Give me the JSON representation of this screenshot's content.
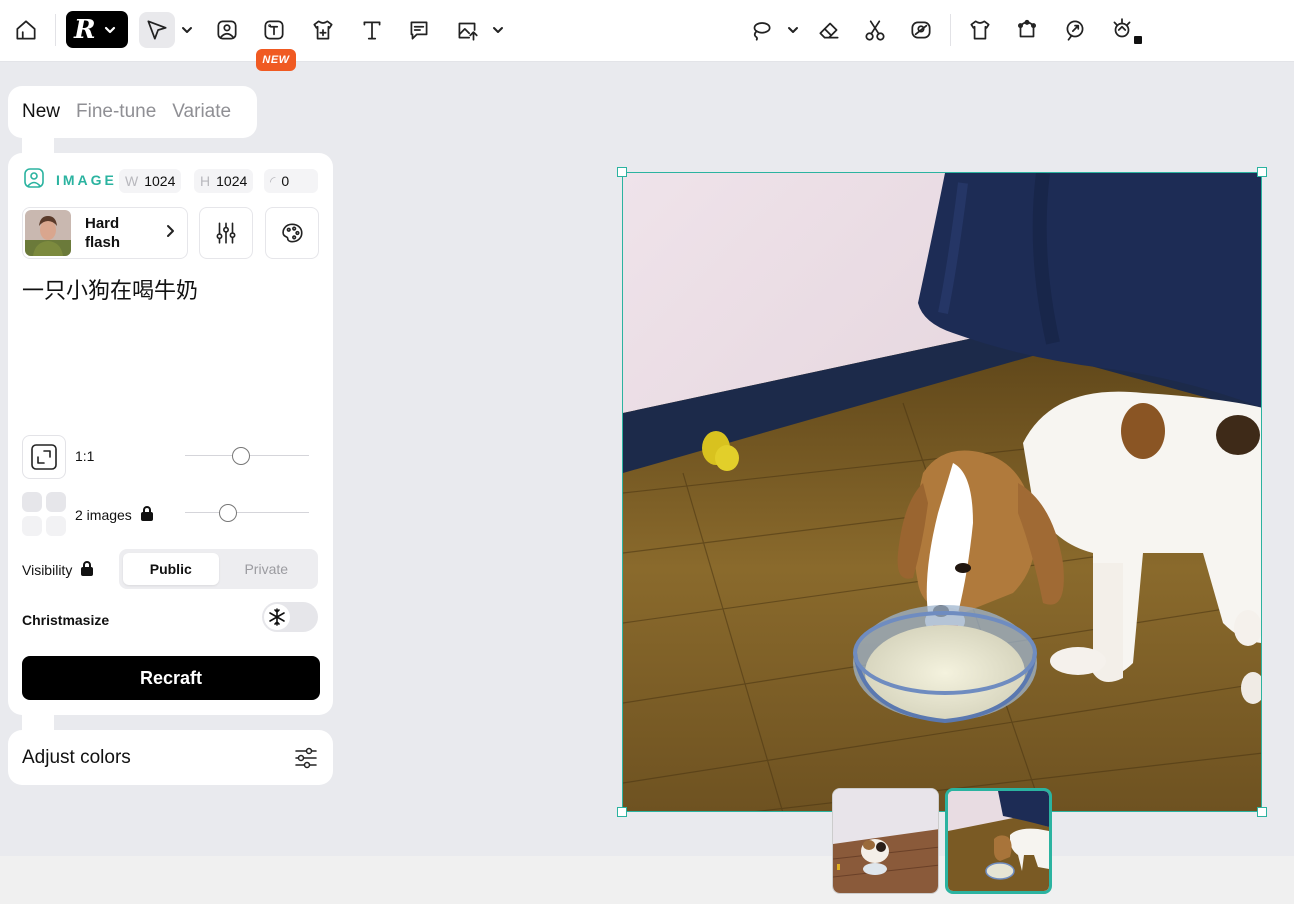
{
  "toolbar": {
    "badge": "NEW",
    "tools": [
      "home-icon",
      "pointer-icon",
      "image-icon",
      "text-to-image-icon",
      "mockup-shirt-icon",
      "text-icon",
      "comment-icon",
      "upload-icon",
      "lasso-icon",
      "eraser-icon",
      "scissors-icon",
      "remove-bg-icon",
      "tshirt-icon",
      "vectorize-icon",
      "creative-upscale-icon",
      "magic-icon"
    ]
  },
  "mode_tabs": [
    "New",
    "Fine-tune",
    "Variate"
  ],
  "panel": {
    "image_label": "IMAGE",
    "width_key": "W",
    "width": "1024",
    "height_key": "H",
    "height": "1024",
    "rotation": "0",
    "style_name": "Hard flash",
    "prompt": "一只小狗在喝牛奶",
    "ratio": "1:1",
    "images_count": "2 images",
    "visibility_label": "Visibility",
    "visibility_options": [
      "Public",
      "Private"
    ],
    "visibility_selected": "Public",
    "christmasize_label": "Christmasize",
    "christmasize_on": false,
    "generate_button": "Recraft",
    "ratio_slider": 0.45,
    "images_slider": 0.35
  },
  "adjust": {
    "label": "Adjust colors"
  },
  "colors": {
    "accent": "#2bb3a0",
    "badge": "#f05a22",
    "primary_button": "#000000"
  },
  "canvas": {
    "thumbnails_count": 2,
    "selected_thumbnail": 2
  }
}
